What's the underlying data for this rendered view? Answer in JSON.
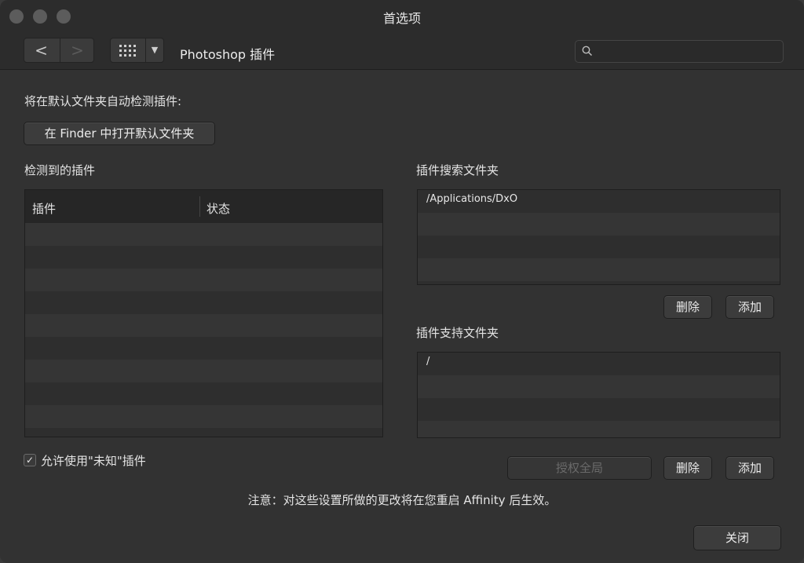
{
  "window": {
    "title": "首选项"
  },
  "toolbar": {
    "back_glyph": "<",
    "forward_glyph": ">",
    "dropdown_glyph": "▼",
    "breadcrumb": "Photoshop 插件",
    "search": {
      "placeholder": "",
      "value": ""
    }
  },
  "main": {
    "auto_detect_label": "将在默认文件夹自动检测插件:",
    "open_finder_button": "在 Finder 中打开默认文件夹",
    "detected_plugins": {
      "title": "检测到的插件",
      "columns": [
        "插件",
        "状态"
      ],
      "rows": []
    },
    "search_folders": {
      "title": "插件搜索文件夹",
      "items": [
        "/Applications/DxO"
      ],
      "delete_button": "删除",
      "add_button": "添加"
    },
    "support_folders": {
      "title": "插件支持文件夹",
      "items": [
        "/"
      ],
      "authorize_button": "授权全局",
      "delete_button": "删除",
      "add_button": "添加"
    },
    "allow_unknown": {
      "label": "允许使用\"未知\"插件",
      "checked": true,
      "check_glyph": "✓"
    },
    "note": "注意：对这些设置所做的更改将在您重启 Affinity 后生效。",
    "close_button": "关闭"
  },
  "icons": [
    "search-icon",
    "grid-icon"
  ]
}
